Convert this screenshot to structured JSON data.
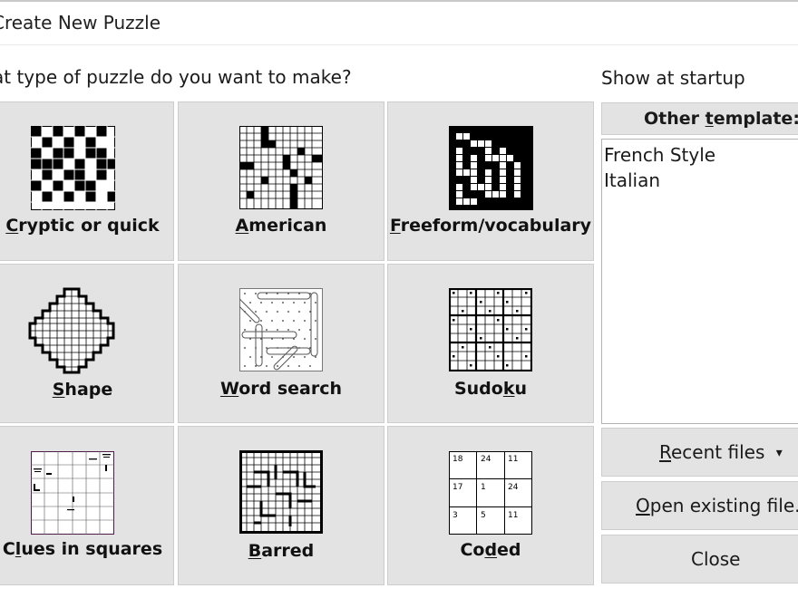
{
  "window": {
    "title": "Create New Puzzle"
  },
  "prompt": "at type of puzzle do you want to make?",
  "show_at_startup": "Show at startup",
  "puzzle_types": [
    {
      "pre": "",
      "key": "C",
      "post": "ryptic or quick",
      "icon": "cryptic-grid-icon"
    },
    {
      "pre": "",
      "key": "A",
      "post": "merican",
      "icon": "american-grid-icon"
    },
    {
      "pre": "",
      "key": "F",
      "post": "reeform/vocabulary",
      "icon": "freeform-grid-icon"
    },
    {
      "pre": "",
      "key": "S",
      "post": "hape",
      "icon": "diamond-shape-icon"
    },
    {
      "pre": "",
      "key": "W",
      "post": "ord search",
      "icon": "word-search-icon"
    },
    {
      "pre": "Sudo",
      "key": "k",
      "post": "u",
      "icon": "sudoku-grid-icon"
    },
    {
      "pre": "C",
      "key": "l",
      "post": "ues in squares",
      "icon": "clues-in-squares-icon"
    },
    {
      "pre": "",
      "key": "B",
      "post": "arred",
      "icon": "barred-grid-icon"
    },
    {
      "pre": "Co",
      "key": "d",
      "post": "ed",
      "icon": "coded-grid-icon"
    }
  ],
  "other_template": {
    "pre": "Other ",
    "key": "t",
    "post": "emplate:"
  },
  "templates": [
    "French Style",
    "Italian"
  ],
  "recent_files": {
    "pre": "",
    "key": "R",
    "post": "ecent files",
    "arrow": "▾"
  },
  "open_existing": {
    "pre": "",
    "key": "O",
    "post": "pen existing file..."
  },
  "close": "Close",
  "coded_numbers": [
    "18",
    "24",
    "11",
    "17",
    "1",
    "24",
    "3",
    "5",
    "11"
  ],
  "colors": {
    "tile_bg": "#e3e3e3",
    "tile_border": "#cdcdcd",
    "text": "#111111"
  }
}
